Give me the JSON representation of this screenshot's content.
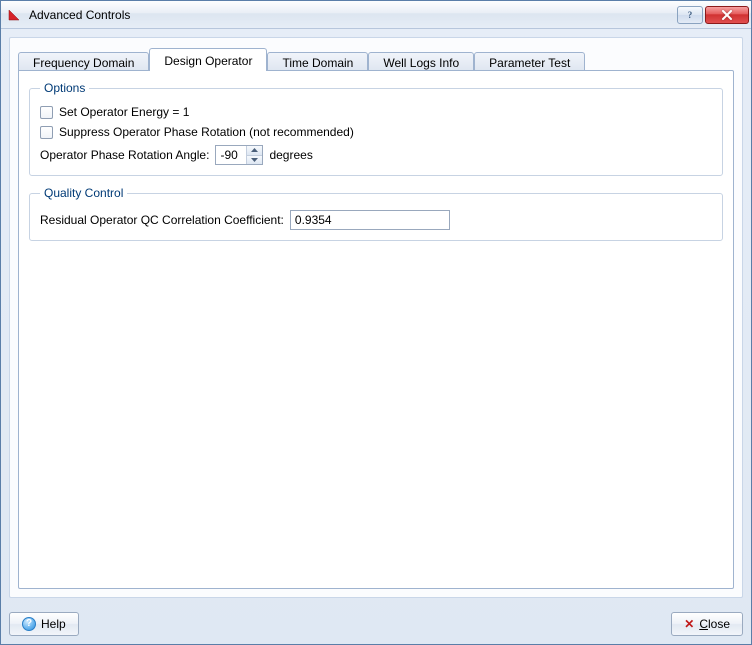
{
  "window": {
    "title": "Advanced Controls"
  },
  "tabs": [
    {
      "label": "Frequency Domain"
    },
    {
      "label": "Design Operator"
    },
    {
      "label": "Time Domain"
    },
    {
      "label": "Well Logs Info"
    },
    {
      "label": "Parameter Test"
    }
  ],
  "active_tab_index": 1,
  "options_group": {
    "legend": "Options",
    "set_energy_label": "Set Operator Energy = 1",
    "set_energy_checked": false,
    "suppress_phase_label": "Suppress Operator Phase Rotation (not recommended)",
    "suppress_phase_checked": false,
    "rotation_angle_label": "Operator Phase Rotation Angle:",
    "rotation_angle_value": "-90",
    "rotation_units": "degrees"
  },
  "qc_group": {
    "legend": "Quality Control",
    "coeff_label": "Residual Operator QC Correlation Coefficient:",
    "coeff_value": "0.9354"
  },
  "footer": {
    "help_label": "Help",
    "close_label": "lose",
    "close_underline": "C"
  }
}
